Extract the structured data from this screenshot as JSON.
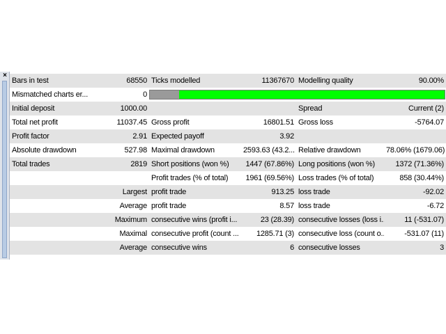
{
  "report": {
    "rows": [
      {
        "c0": "Bars in test",
        "c1": "68550",
        "c2": "Ticks modelled",
        "c3": "11367670",
        "c4": "Modelling quality",
        "c5": "90.00%"
      },
      {
        "c0": "Mismatched charts er...",
        "c1": "0"
      },
      {
        "c0": "Initial deposit",
        "c1": "1000.00",
        "c2": "",
        "c3": "",
        "c4": "Spread",
        "c5": "Current (2)"
      },
      {
        "c0": "Total net profit",
        "c1": "11037.45",
        "c2": "Gross profit",
        "c3": "16801.51",
        "c4": "Gross loss",
        "c5": "-5764.07"
      },
      {
        "c0": "Profit factor",
        "c1": "2.91",
        "c2": "Expected payoff",
        "c3": "3.92",
        "c4": "",
        "c5": ""
      },
      {
        "c0": "Absolute drawdown",
        "c1": "527.98",
        "c2": "Maximal drawdown",
        "c3": "2593.63 (43.2...",
        "c4": "Relative drawdown",
        "c5": "78.06% (1679.06)"
      },
      {
        "c0": "Total trades",
        "c1": "2819",
        "c2": "Short positions (won %)",
        "c3": "1447 (67.86%)",
        "c4": "Long positions (won %)",
        "c5": "1372 (71.36%)"
      },
      {
        "c0": "",
        "c1": "",
        "c2": "Profit trades (% of total)",
        "c3": "1961 (69.56%)",
        "c4": "Loss trades (% of total)",
        "c5": "858 (30.44%)"
      },
      {
        "c0": "",
        "c1": "Largest",
        "c2": "profit trade",
        "c3": "913.25",
        "c4": "loss trade",
        "c5": "-92.02"
      },
      {
        "c0": "",
        "c1": "Average",
        "c2": "profit trade",
        "c3": "8.57",
        "c4": "loss trade",
        "c5": "-6.72"
      },
      {
        "c0": "",
        "c1": "Maximum",
        "c2": "consecutive wins (profit i...",
        "c3": "23 (28.39)",
        "c4": "consecutive losses (loss i...",
        "c5": "11 (-531.07)"
      },
      {
        "c0": "",
        "c1": "Maximal",
        "c2": "consecutive profit (count ...",
        "c3": "1285.71 (3)",
        "c4": "consecutive loss (count o...",
        "c5": "-531.07 (11)"
      },
      {
        "c0": "",
        "c1": "Average",
        "c2": "consecutive wins",
        "c3": "6",
        "c4": "consecutive losses",
        "c5": "3"
      }
    ],
    "quality_bar": {
      "fraction": 0.9,
      "color": "#00ff00",
      "background": "#9a9a9a"
    }
  },
  "dock": {
    "close_icon": "close-icon"
  },
  "colors": {
    "row_gray": "#e3e3e3",
    "row_white": "#ffffff",
    "dock_bar": "#b8cbe4"
  }
}
